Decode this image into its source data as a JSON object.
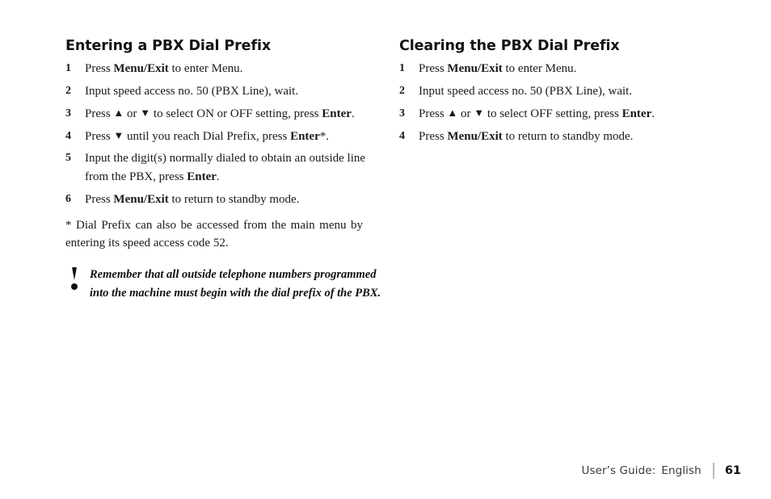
{
  "page": {
    "footer": {
      "guide_label": "User’s Guide:",
      "language": "English",
      "page_number": "61"
    }
  },
  "left_column": {
    "heading": "Entering a PBX Dial Prefix",
    "steps": [
      {
        "num": "1",
        "parts": [
          {
            "t": "Press ",
            "s": "normal"
          },
          {
            "t": "Menu/Exit",
            "s": "bold"
          },
          {
            "t": " to enter Menu.",
            "s": "normal"
          }
        ]
      },
      {
        "num": "2",
        "parts": [
          {
            "t": "Input speed access no. 50 (PBX Line), wait.",
            "s": "normal"
          }
        ]
      },
      {
        "num": "3",
        "parts": [
          {
            "t": "Press ",
            "s": "normal"
          },
          {
            "t": "▲",
            "s": "triangle-up"
          },
          {
            "t": " or ",
            "s": "normal"
          },
          {
            "t": "▼",
            "s": "triangle-down"
          },
          {
            "t": " to select ON or OFF setting, press ",
            "s": "normal"
          },
          {
            "t": "Enter",
            "s": "bold"
          },
          {
            "t": ".",
            "s": "normal"
          }
        ]
      },
      {
        "num": "4",
        "parts": [
          {
            "t": "Press ",
            "s": "normal"
          },
          {
            "t": "▼",
            "s": "triangle-down"
          },
          {
            "t": " until you reach Dial Prefix, press ",
            "s": "normal"
          },
          {
            "t": "Enter",
            "s": "bold"
          },
          {
            "t": "*.",
            "s": "normal"
          }
        ]
      },
      {
        "num": "5",
        "parts": [
          {
            "t": "Input the digit(s) normally dialed to obtain an outside line from the PBX, press ",
            "s": "normal"
          },
          {
            "t": "Enter",
            "s": "bold"
          },
          {
            "t": ".",
            "s": "normal"
          }
        ]
      },
      {
        "num": "6",
        "parts": [
          {
            "t": "Press ",
            "s": "normal"
          },
          {
            "t": "Menu/Exit",
            "s": "bold"
          },
          {
            "t": " to return to standby mode.",
            "s": "normal"
          }
        ]
      }
    ],
    "footnote": "* Dial Prefix can also be accessed from the main menu by entering its speed access code 52.",
    "note": {
      "icon": "exclamation-icon",
      "text": "Remember that all outside telephone numbers programmed into the machine must begin with the dial prefix of the PBX."
    }
  },
  "right_column": {
    "heading": "Clearing the PBX Dial Prefix",
    "steps": [
      {
        "num": "1",
        "parts": [
          {
            "t": "Press ",
            "s": "normal"
          },
          {
            "t": "Menu/Exit",
            "s": "bold"
          },
          {
            "t": " to enter Menu.",
            "s": "normal"
          }
        ]
      },
      {
        "num": "2",
        "parts": [
          {
            "t": "Input speed access no. 50 (PBX Line), wait.",
            "s": "normal"
          }
        ]
      },
      {
        "num": "3",
        "parts": [
          {
            "t": "Press ",
            "s": "normal"
          },
          {
            "t": "▲",
            "s": "triangle-up"
          },
          {
            "t": " or ",
            "s": "normal"
          },
          {
            "t": "▼",
            "s": "triangle-down"
          },
          {
            "t": " to select OFF setting, press ",
            "s": "normal"
          },
          {
            "t": "Enter",
            "s": "bold"
          },
          {
            "t": ".",
            "s": "normal"
          }
        ]
      },
      {
        "num": "4",
        "parts": [
          {
            "t": "Press ",
            "s": "normal"
          },
          {
            "t": "Menu/Exit",
            "s": "bold"
          },
          {
            "t": " to return to standby mode.",
            "s": "normal"
          }
        ]
      }
    ]
  }
}
